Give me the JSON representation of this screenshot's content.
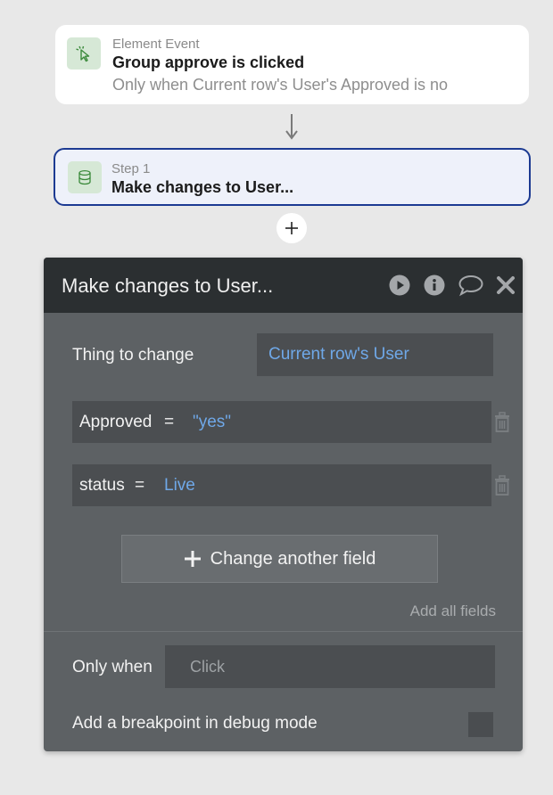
{
  "event_card": {
    "kicker": "Element Event",
    "title": "Group approve is clicked",
    "condition": "Only when Current row's User's Approved is no",
    "icon": "cursor-click-icon"
  },
  "step_card": {
    "kicker": "Step 1",
    "title": "Make changes to User...",
    "icon": "database-icon"
  },
  "panel": {
    "title": "Make changes to User...",
    "header_icons": [
      "play-icon",
      "info-icon",
      "comment-icon",
      "close-icon"
    ],
    "thing_to_change_label": "Thing to change",
    "thing_to_change_value": "Current row's User",
    "fields": [
      {
        "key": "Approved",
        "eq": "=",
        "value": "\"yes\""
      },
      {
        "key": "status",
        "eq": "=",
        "value": "Live"
      }
    ],
    "change_another_label": "Change another field",
    "add_all_label": "Add all fields",
    "only_when_label": "Only when",
    "only_when_placeholder": "Click",
    "breakpoint_label": "Add a breakpoint in debug mode"
  },
  "colors": {
    "accent_blue": "#1c3a92",
    "value_blue": "#6fa8e8",
    "panel_bg": "#5d6164",
    "header_bg": "#2b2f31"
  }
}
